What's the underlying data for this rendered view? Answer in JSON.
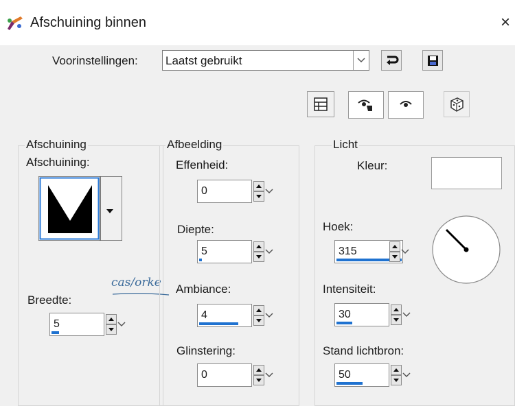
{
  "window": {
    "title": "Afschuining binnen",
    "close_glyph": "×"
  },
  "presets": {
    "label": "Voorinstellingen:",
    "value": "Laatst gebruikt"
  },
  "icons": {
    "app": "brush-icon",
    "reset": "reset-arrow-icon",
    "save": "save-disk-icon",
    "preview_layout": "preview-layout-icon",
    "proof_eye": "proof-eye-icon",
    "eye": "eye-icon",
    "randomize": "dice-icon"
  },
  "bevel_group": {
    "legend": "Afschuining",
    "shape_label": "Afschuining:",
    "width_label": "Breedte:",
    "width_value": "5",
    "width_fill": 0.15
  },
  "image_group": {
    "legend": "Afbeelding",
    "smoothness_label": "Effenheid:",
    "smoothness_value": "0",
    "smoothness_fill": 0.0,
    "depth_label": "Diepte:",
    "depth_value": "5",
    "depth_fill": 0.05,
    "ambience_label": "Ambiance:",
    "ambience_value": "4",
    "ambience_fill": 0.75,
    "shininess_label": "Glinstering:",
    "shininess_value": "0",
    "shininess_fill": 0.0
  },
  "light_group": {
    "legend": "Licht",
    "color_label": "Kleur:",
    "color": "#ffffff",
    "angle_label": "Hoek:",
    "angle_value": "315",
    "angle_fill": 0.99,
    "intensity_label": "Intensiteit:",
    "intensity_value": "30",
    "intensity_fill": 0.3,
    "elevation_label": "Stand lichtbron:",
    "elevation_value": "50",
    "elevation_fill": 0.5
  },
  "watermark": {
    "text": "cas/orke"
  },
  "colors": {
    "accent": "#1f72d0",
    "window_bg": "#f0f0f0",
    "titlebar_bg": "#ffffff"
  }
}
